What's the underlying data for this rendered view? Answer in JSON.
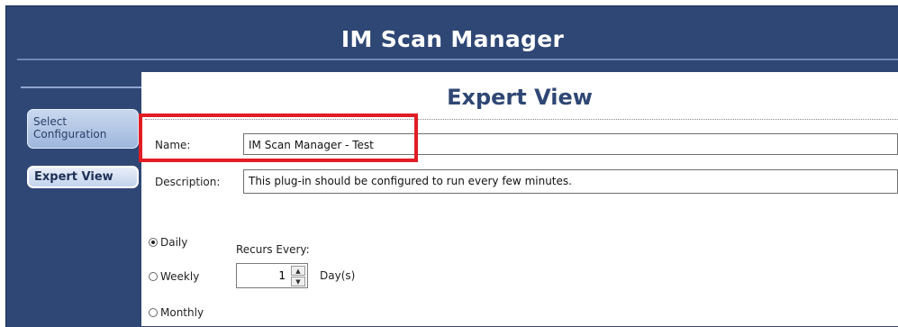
{
  "window": {
    "title": "IM Scan Manager"
  },
  "sidebar": {
    "items": [
      {
        "label": "Select Configuration"
      },
      {
        "label": "Expert View"
      }
    ]
  },
  "main": {
    "heading": "Expert View",
    "name": {
      "label": "Name:",
      "value": "IM Scan Manager - Test"
    },
    "description": {
      "label": "Description:",
      "value": "This plug-in should be configured to run every few minutes."
    },
    "schedule": {
      "options": [
        "Daily",
        "Weekly",
        "Monthly"
      ],
      "selected": "Daily",
      "recurs_label": "Recurs Every:",
      "recurs_value": "1",
      "unit": "Day(s)"
    }
  },
  "colors": {
    "header": "#2f4774",
    "highlight": "#e11d24"
  }
}
